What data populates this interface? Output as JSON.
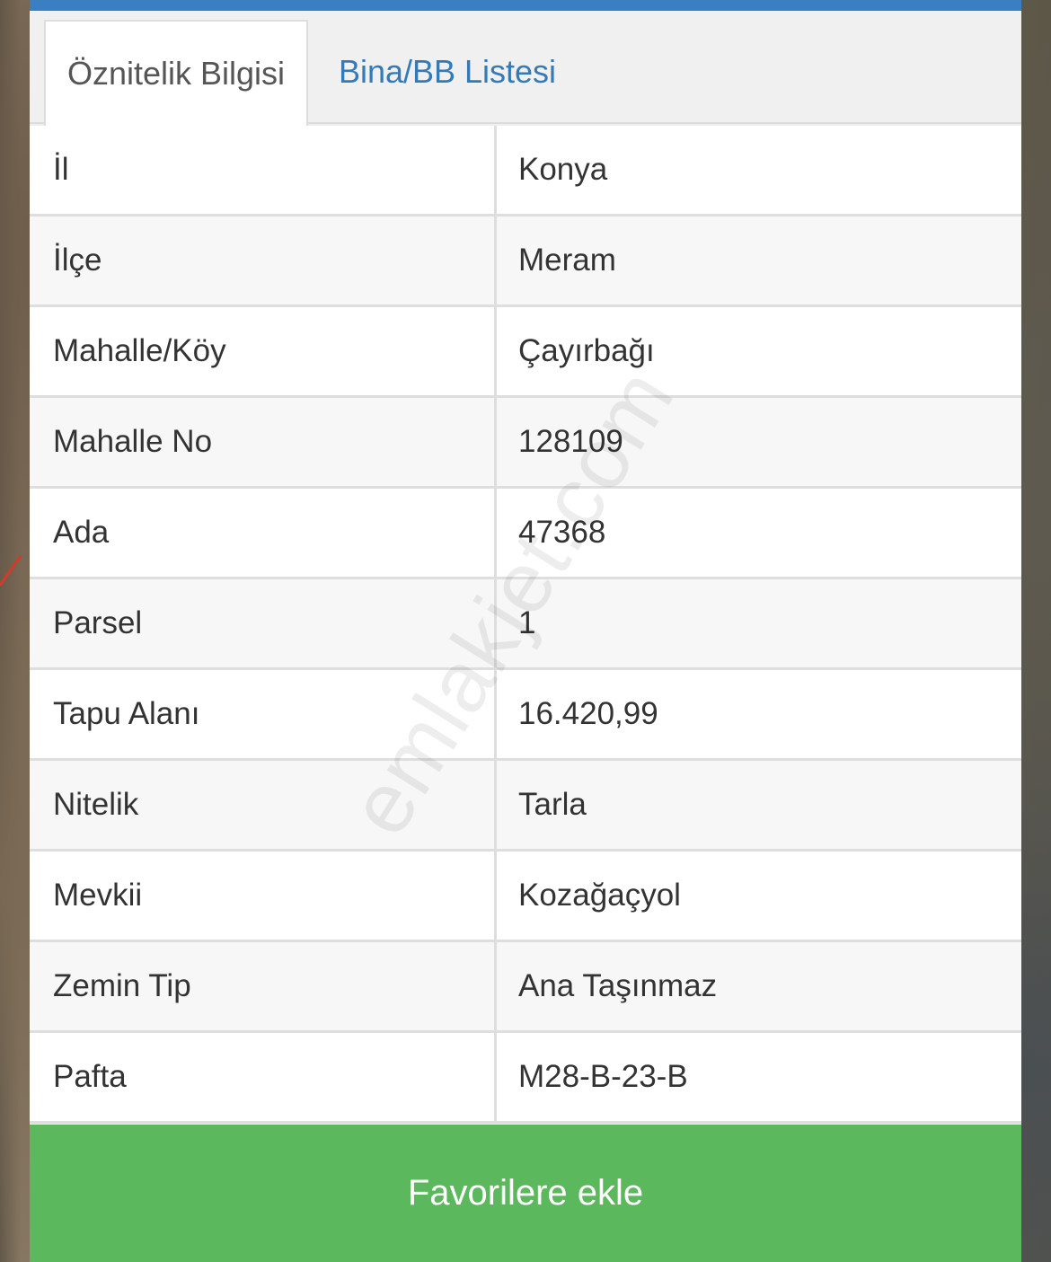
{
  "tabs": [
    {
      "label": "Öznitelik Bilgisi",
      "active": true
    },
    {
      "label": "Bina/BB Listesi",
      "active": false
    }
  ],
  "rows": [
    {
      "key": "İl",
      "value": "Konya"
    },
    {
      "key": "İlçe",
      "value": "Meram"
    },
    {
      "key": "Mahalle/Köy",
      "value": "Çayırbağı"
    },
    {
      "key": "Mahalle No",
      "value": "128109"
    },
    {
      "key": "Ada",
      "value": "47368"
    },
    {
      "key": "Parsel",
      "value": "1"
    },
    {
      "key": "Tapu Alanı",
      "value": "16.420,99"
    },
    {
      "key": "Nitelik",
      "value": "Tarla"
    },
    {
      "key": "Mevkii",
      "value": "Kozağaçyol"
    },
    {
      "key": "Zemin Tip",
      "value": "Ana Taşınmaz"
    },
    {
      "key": "Pafta",
      "value": "M28-B-23-B"
    }
  ],
  "favorite_button": {
    "label": "Favorilere ekle"
  },
  "watermark": "emlakjet.com",
  "colors": {
    "header_bar": "#3a7fc1",
    "tab_link": "#337ab7",
    "button": "#5cb85c"
  }
}
